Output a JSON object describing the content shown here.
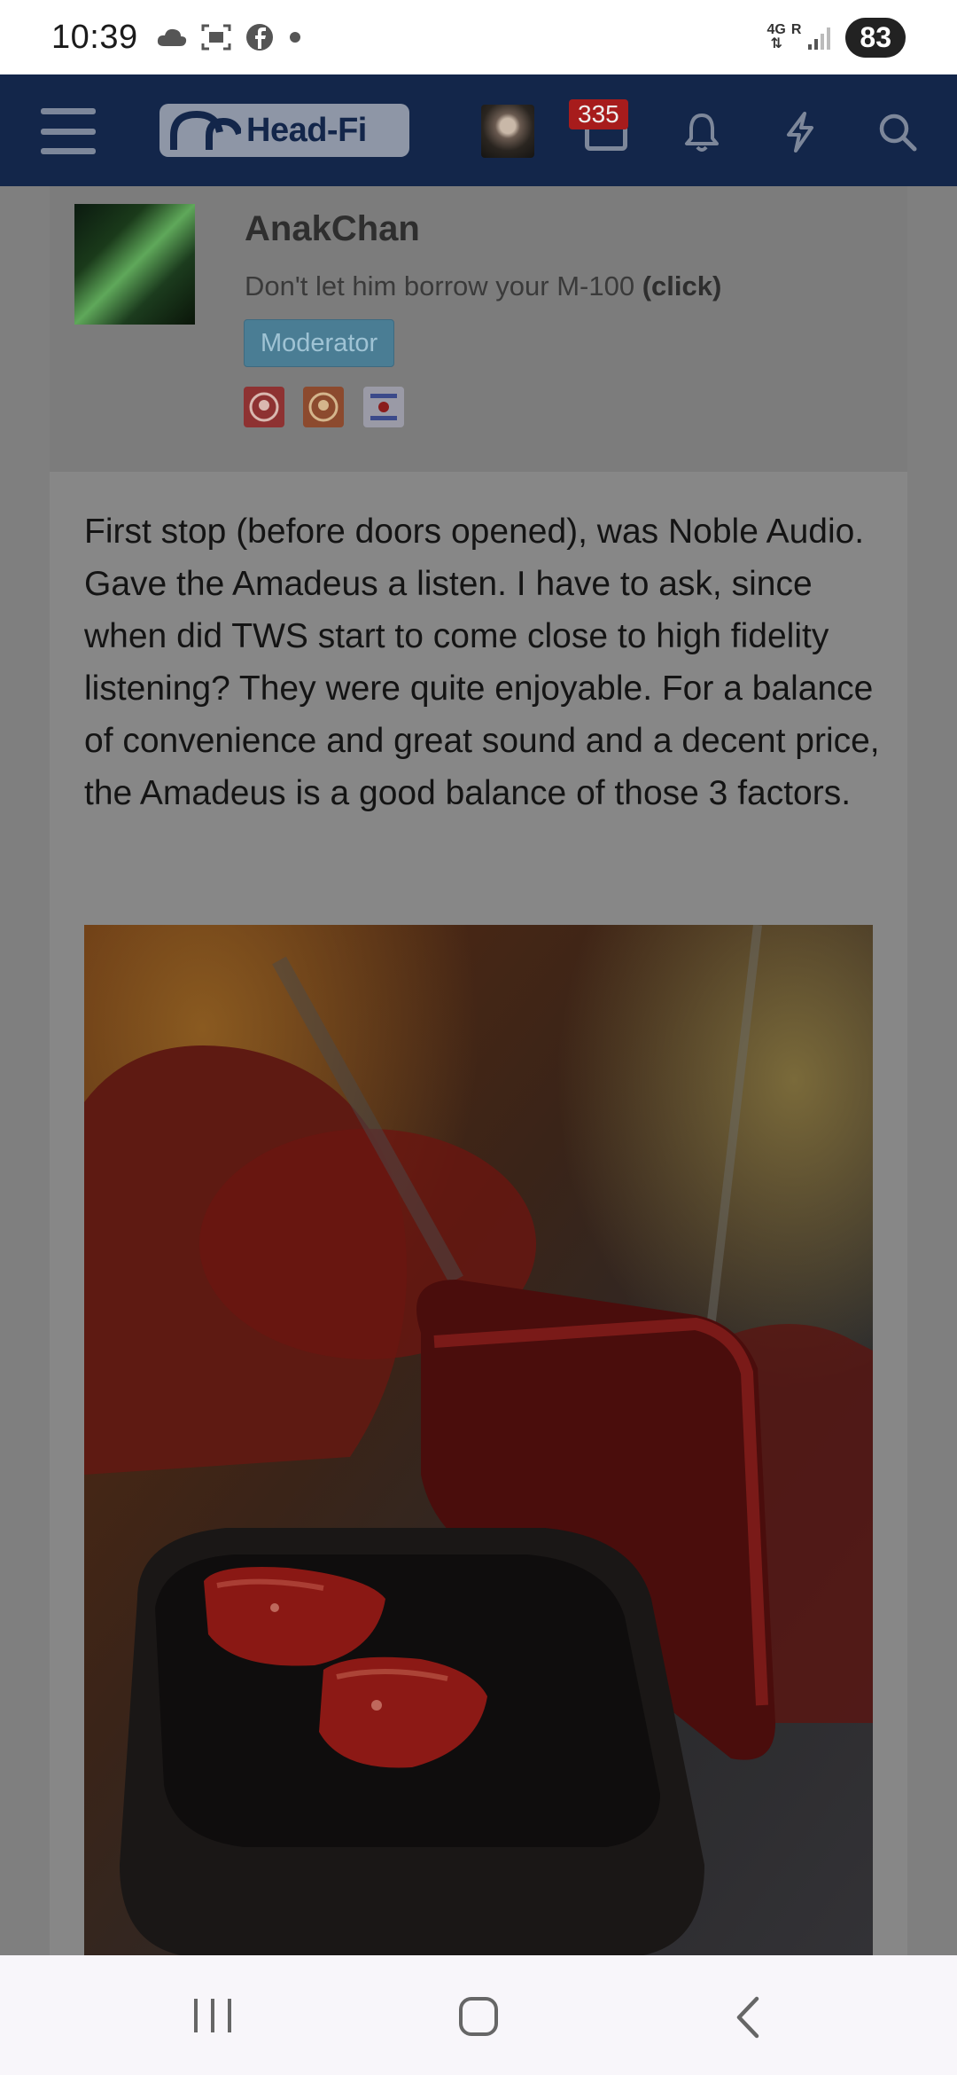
{
  "status_bar": {
    "time": "10:39",
    "network_top": "4G",
    "network_roam": "R",
    "battery": "83",
    "left_icons": [
      "cloud-icon",
      "screenshot-icon",
      "facebook-icon",
      "dot-icon"
    ]
  },
  "header": {
    "logo_text": "Head-Fi",
    "notification_count": "335",
    "icons": [
      "menu-icon",
      "avatar",
      "inbox-icon",
      "bell-icon",
      "lightning-icon",
      "search-icon"
    ]
  },
  "post": {
    "username": "AnakChan",
    "user_title": "Don't let him borrow your M-100",
    "user_title_link": "(click)",
    "role_badge": "Moderator",
    "body": "First stop (before doors opened), was Noble Audio. Gave the Amadeus a listen. I have to ask, since when did TWS start to come close to high fidelity listening? They were quite enjoyable. For a balance of convenience and great sound and a decent price, the Amadeus is a good balance of those 3 factors."
  },
  "nav": {
    "buttons": [
      "recent-apps-button",
      "home-button",
      "back-button"
    ]
  },
  "colors": {
    "header_bg": "#13264a",
    "overlay_content": "#7f7f7f",
    "badge_red": "#a71c1c",
    "moderator_badge": "#4a7d94"
  }
}
